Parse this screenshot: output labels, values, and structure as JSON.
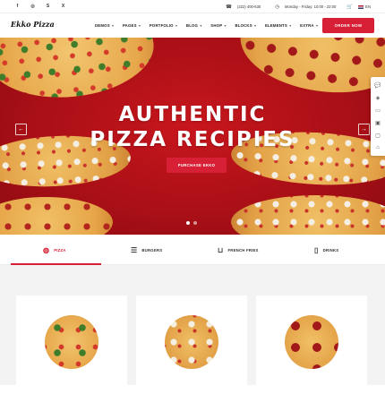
{
  "topbar": {
    "social_icons": [
      "facebook-icon",
      "instagram-icon",
      "skype-icon",
      "x-icon"
    ],
    "phone": "(222) 400-630",
    "hours": "Monday - Friday: 10:00 - 22:00",
    "language": "EN"
  },
  "header": {
    "logo": "Ekko Pizza",
    "nav": [
      {
        "label": "DEMOS"
      },
      {
        "label": "PAGES"
      },
      {
        "label": "PORTFOLIO"
      },
      {
        "label": "BLOG"
      },
      {
        "label": "SHOP"
      },
      {
        "label": "BLOCKS"
      },
      {
        "label": "ELEMENTS"
      },
      {
        "label": "EXTRA"
      }
    ],
    "order_button": "ORDER NOW"
  },
  "hero": {
    "title_line1": "AUTHENTIC",
    "title_line2": "PIZZA RECIPIES",
    "button": "PURCHASE EKKO",
    "slides": 2,
    "active_slide": 1
  },
  "tabs": [
    {
      "label": "PIZZA",
      "icon": "pizza-icon",
      "active": true
    },
    {
      "label": "BURGERS",
      "icon": "burger-icon",
      "active": false
    },
    {
      "label": "FRENCH FRIES",
      "icon": "fries-icon",
      "active": false
    },
    {
      "label": "DRINKS",
      "icon": "drink-icon",
      "active": false
    }
  ],
  "colors": {
    "accent": "#d71f35",
    "hero_bg": "#b3121a"
  }
}
